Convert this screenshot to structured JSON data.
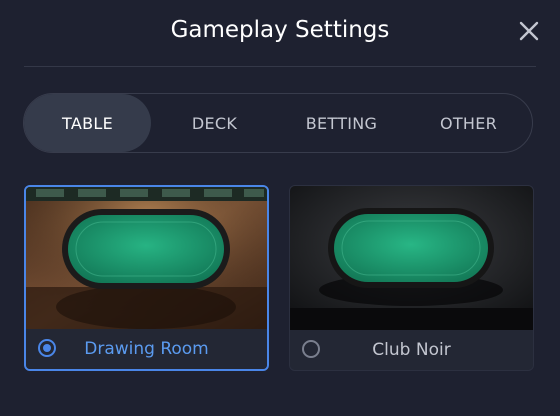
{
  "dialog": {
    "title": "Gameplay Settings"
  },
  "tabs": [
    {
      "label": "TABLE",
      "active": true
    },
    {
      "label": "DECK",
      "active": false
    },
    {
      "label": "BETTING",
      "active": false
    },
    {
      "label": "OTHER",
      "active": false
    }
  ],
  "tables": [
    {
      "label": "Drawing Room",
      "selected": true
    },
    {
      "label": "Club Noir",
      "selected": false
    }
  ],
  "colors": {
    "background": "#1e2130",
    "accent": "#4a86e8",
    "felt": "#1fa57a"
  },
  "icons": {
    "close": "close-icon"
  }
}
